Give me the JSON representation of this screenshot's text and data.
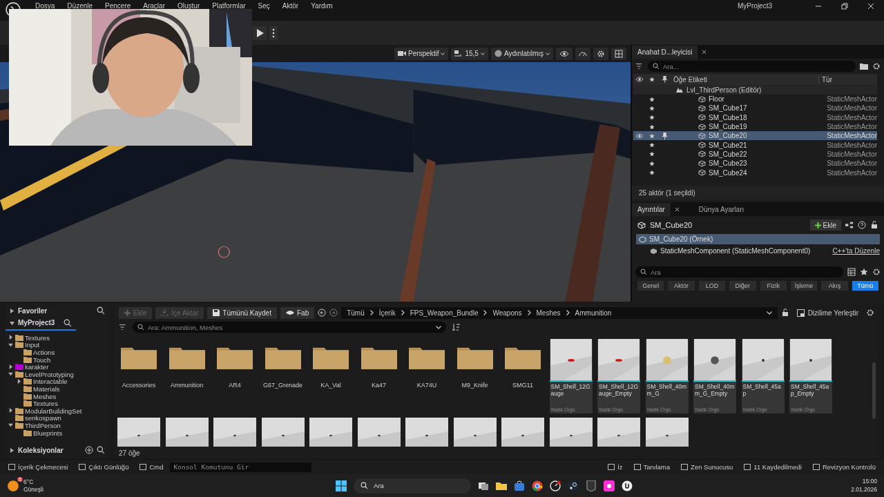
{
  "menu": {
    "items": [
      "Dosya",
      "Düzenle",
      "Pencere",
      "Araçlar",
      "Oluştur",
      "Platformlar",
      "Seç",
      "Aktör",
      "Yardım"
    ],
    "project": "MyProject3"
  },
  "viewport": {
    "perspective": "Perspektif",
    "camera_speed": "15,5",
    "view_mode": "Aydınlatılmış"
  },
  "outliner": {
    "tab": "Anahat D...leyicisi",
    "search": {
      "placeholder": "Ara..."
    },
    "columns": [
      "Öğe Etiketi",
      "Tür"
    ],
    "level": "Lvl_ThirdPerson (Editör)",
    "rows": [
      {
        "label": "Floor",
        "type": "StaticMeshActor",
        "selected": false
      },
      {
        "label": "SM_Cube17",
        "type": "StaticMeshActor",
        "selected": false
      },
      {
        "label": "SM_Cube18",
        "type": "StaticMeshActor",
        "selected": false
      },
      {
        "label": "SM_Cube19",
        "type": "StaticMeshActor",
        "selected": false
      },
      {
        "label": "SM_Cube20",
        "type": "StaticMeshActor",
        "selected": true
      },
      {
        "label": "SM_Cube21",
        "type": "StaticMeshActor",
        "selected": false
      },
      {
        "label": "SM_Cube22",
        "type": "StaticMeshActor",
        "selected": false
      },
      {
        "label": "SM_Cube23",
        "type": "StaticMeshActor",
        "selected": false
      },
      {
        "label": "SM_Cube24",
        "type": "StaticMeshActor",
        "selected": false
      }
    ],
    "status": "25 aktör (1 seçildi)"
  },
  "details": {
    "tabs": [
      {
        "label": "Ayrıntılar",
        "selected": true
      },
      {
        "label": "Dünya Ayarları",
        "selected": false
      }
    ],
    "actor": "SM_Cube20",
    "add_button": "Ekle",
    "components": [
      {
        "label": "SM_Cube20 (Örnek)",
        "selected": true,
        "children": [
          {
            "label": "StaticMeshComponent (StaticMeshComponent0)",
            "selected": false
          }
        ]
      }
    ],
    "edit_link": "C++'ta Düzenle",
    "search": {
      "placeholder": "Ara"
    },
    "filters": [
      {
        "label": "Genel",
        "selected": false
      },
      {
        "label": "Aktör",
        "selected": false
      },
      {
        "label": "LOD",
        "selected": false
      },
      {
        "label": "Diğer",
        "selected": false
      },
      {
        "label": "Fizik",
        "selected": false
      },
      {
        "label": "İşleme",
        "selected": false
      },
      {
        "label": "Akış",
        "selected": false
      },
      {
        "label": "Tümü",
        "selected": true
      }
    ]
  },
  "content_browser": {
    "favorites": "Favoriler",
    "project": "MyProject3",
    "collections": "Koleksiyonlar",
    "tree": [
      {
        "label": "Textures",
        "kind": "branch",
        "expanded": false,
        "color": "#c8a064"
      },
      {
        "label": "Input",
        "kind": "branch",
        "expanded": true,
        "color": "#c8a064",
        "children": [
          {
            "label": "Actions",
            "kind": "leaf",
            "color": "#c8a064"
          },
          {
            "label": "Touch",
            "kind": "leaf",
            "color": "#c8a064"
          }
        ]
      },
      {
        "label": "karakter",
        "kind": "branch",
        "expanded": false,
        "color": "#b400d2"
      },
      {
        "label": "LevelPrototyping",
        "kind": "branch",
        "expanded": true,
        "color": "#c8a064",
        "children": [
          {
            "label": "Interactable",
            "kind": "branch",
            "expanded": false,
            "color": "#c8a064"
          },
          {
            "label": "Materials",
            "kind": "leaf",
            "color": "#c8a064"
          },
          {
            "label": "Meshes",
            "kind": "leaf",
            "color": "#c8a064"
          },
          {
            "label": "Textures",
            "kind": "leaf",
            "color": "#c8a064"
          }
        ]
      },
      {
        "label": "ModularBuildingSet",
        "kind": "branch",
        "expanded": false,
        "color": "#c8a064"
      },
      {
        "label": "senkospawn",
        "kind": "leaf",
        "color": "#c8a064"
      },
      {
        "label": "ThirdPerson",
        "kind": "branch",
        "expanded": true,
        "color": "#c8a064",
        "children": [
          {
            "label": "Blueprints",
            "kind": "leaf",
            "color": "#c8a064"
          }
        ]
      }
    ],
    "toolbar": [
      {
        "label": "Ekle",
        "kind": "add",
        "disabled": true
      },
      {
        "label": "İçe Aktar",
        "kind": "import",
        "disabled": true
      },
      {
        "label": "Tümünü Kaydet",
        "kind": "save",
        "disabled": false
      },
      {
        "label": "Fab",
        "kind": "fab",
        "disabled": false
      }
    ],
    "path": [
      "Tümü",
      "İçerik",
      "FPS_Weapon_Bundle",
      "Weapons",
      "Meshes",
      "Ammunition"
    ],
    "dock_button": "Dizilime Yerleştir",
    "search": {
      "placeholder": "Ara: Ammunition, Meshes"
    },
    "folders": [
      "Accessories",
      "Ammunition",
      "AR4",
      "G67_Grenade",
      "KA_Val",
      "Ka47",
      "KA74U",
      "M9_Knife",
      "SMG11"
    ],
    "assets": [
      {
        "name": "SM_Shell_12Gauge",
        "type": "Statik Örgü"
      },
      {
        "name": "SM_Shell_12Gauge_Empty",
        "type": "Statik Örgü"
      },
      {
        "name": "SM_Shell_40mm_G",
        "type": "Statik Örgü"
      },
      {
        "name": "SM_Shell_40mm_G_Empty",
        "type": "Statik Örgü"
      },
      {
        "name": "SM_Shell_45ap",
        "type": "Statik Örgü"
      },
      {
        "name": "SM_Shell_45ap_Empty",
        "type": "Statik Örgü"
      }
    ],
    "more_assets": [
      {
        "kind": "picture"
      },
      {
        "kind": "picture"
      },
      {
        "kind": "picture"
      },
      {
        "kind": "picture"
      },
      {
        "kind": "picture"
      },
      {
        "kind": "picture"
      },
      {
        "kind": "picture"
      },
      {
        "kind": "picture"
      },
      {
        "kind": "picture"
      },
      {
        "kind": "picture"
      },
      {
        "kind": "picture"
      },
      {
        "kind": "picture"
      }
    ],
    "count": "27 öğe"
  },
  "status_bar": {
    "left": [
      "İçerik Çekmecesi",
      "Çıktı Günlüğü",
      "Cmd"
    ],
    "console": {
      "placeholder": "Konsol Komutunu Gir"
    },
    "right": [
      "İz",
      "Tanılama",
      "Zen Sunucusu",
      "11 Kaydedilmedi",
      "Revizyon Kontrolü"
    ]
  },
  "taskbar": {
    "weather": {
      "temp": "6°C",
      "text": "Güneşli",
      "badge": "5"
    },
    "search": {
      "placeholder": "Ara"
    },
    "time": "15:00",
    "date": "2.01.2026"
  }
}
